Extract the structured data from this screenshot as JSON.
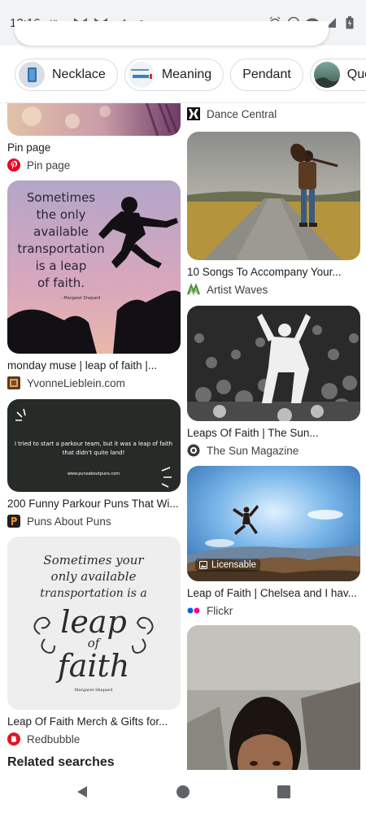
{
  "status_bar": {
    "time": "12:16",
    "notification_icons": [
      "uber-icon",
      "gmail-icon",
      "gmail-icon",
      "tasks-check-icon",
      "dot-icon"
    ],
    "uber_label": "Uber",
    "system_icons": [
      "alarm-icon",
      "do-not-disturb-icon",
      "wifi-icon",
      "cell-signal-icon",
      "battery-icon"
    ]
  },
  "chips": [
    {
      "label": "Necklace",
      "thumb": true
    },
    {
      "label": "Meaning",
      "thumb": true
    },
    {
      "label": "Pendant",
      "thumb": false
    },
    {
      "label": "Quote",
      "thumb": true
    }
  ],
  "pins_left": [
    {
      "title": "Pin page",
      "source": "Pin page",
      "source_icon": "pinterest-icon"
    },
    {
      "title": "monday muse | leap of faith |...",
      "source": "YvonneLieblein.com",
      "source_icon": "site-favicon-icon",
      "image_text": {
        "quote": [
          "Sometimes",
          "the only",
          "available",
          "transportation",
          "is a leap",
          "of faith."
        ],
        "author": "- Margaret Shepard"
      }
    },
    {
      "title": "200 Funny Parkour Puns That Wi...",
      "source": "Puns About Puns",
      "source_icon": "puns-p-icon",
      "image_text": {
        "line1": "I tried to start a parkour team, but it was a leap of faith",
        "line2": "that didn't quite land!",
        "url": "www.punsaboutpuns.com"
      }
    },
    {
      "title": "Leap Of Faith Merch & Gifts for...",
      "source": "Redbubble",
      "source_icon": "redbubble-icon",
      "image_text": {
        "l1": "Sometimes your",
        "l2": "only available",
        "l3": "transportation is a",
        "big1": "leap",
        "small": "of",
        "big2": "faith",
        "author": "Margaret Shepard"
      }
    }
  ],
  "pins_right": [
    {
      "title": "",
      "source": "Dance Central",
      "source_icon": "dance-central-icon"
    },
    {
      "title": "10 Songs To Accompany Your...",
      "source": "Artist Waves",
      "source_icon": "artist-waves-icon"
    },
    {
      "title": "Leaps Of Faith | The Sun...",
      "source": "The Sun Magazine",
      "source_icon": "sun-magazine-icon"
    },
    {
      "title": "Leap of Faith | Chelsea and I hav...",
      "source": "Flickr",
      "source_icon": "flickr-icon",
      "badge": "Licensable"
    },
    {
      "title": "",
      "source": "",
      "source_icon": ""
    }
  ],
  "related": "Related searches",
  "colors": {
    "status_bg": "#f1f3f4",
    "pinterest_red": "#e60023",
    "flickr_blue": "#0063dc",
    "flickr_pink": "#ff0084",
    "redbubble_red": "#e41321",
    "puns_orange": "#f08a24"
  },
  "nav": [
    "back-icon",
    "home-icon",
    "recents-icon"
  ]
}
